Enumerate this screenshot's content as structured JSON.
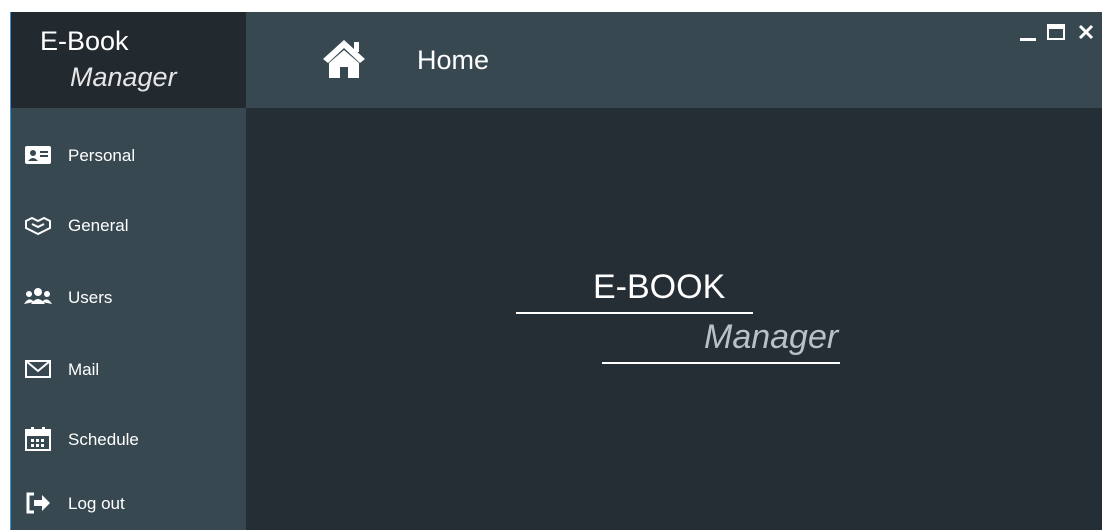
{
  "app": {
    "brand_line1": "E-Book",
    "brand_line2": "Manager"
  },
  "header": {
    "title": "Home",
    "icon": "home-icon"
  },
  "window_controls": [
    "minimize",
    "maximize",
    "close"
  ],
  "sidebar": {
    "items": [
      {
        "label": "Personal",
        "icon": "id-card-icon"
      },
      {
        "label": "General",
        "icon": "handshake-icon"
      },
      {
        "label": "Users",
        "icon": "users-icon"
      },
      {
        "label": "Mail",
        "icon": "envelope-icon"
      },
      {
        "label": "Schedule",
        "icon": "calendar-icon"
      },
      {
        "label": "Log out",
        "icon": "sign-out-icon"
      }
    ]
  },
  "main": {
    "logo_line1": "E-BOOK",
    "logo_line2": "Manager"
  },
  "colors": {
    "sidebar_bg": "#374850",
    "main_bg": "#262e35",
    "brand_bg": "#222a30",
    "accent": "#3a8fd6"
  }
}
